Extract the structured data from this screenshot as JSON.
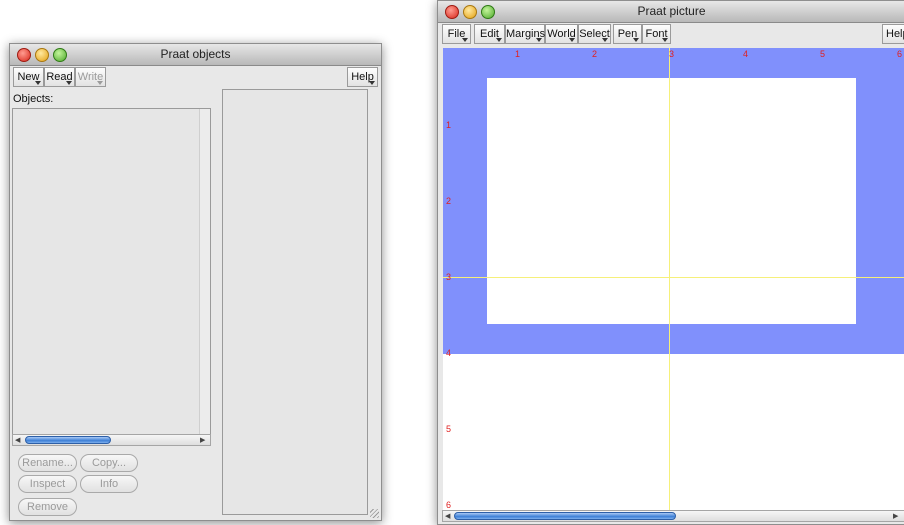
{
  "objects_window": {
    "title": "Praat objects",
    "menus": [
      {
        "label": "New",
        "enabled": true
      },
      {
        "label": "Read",
        "enabled": true
      },
      {
        "label": "Write",
        "enabled": false
      }
    ],
    "help_label": "Help",
    "objects_label": "Objects:",
    "buttons": {
      "rename": "Rename...",
      "copy": "Copy...",
      "inspect": "Inspect",
      "info": "Info",
      "remove": "Remove"
    }
  },
  "picture_window": {
    "title": "Praat picture",
    "menus": [
      "File",
      "Edit",
      "Margins",
      "World",
      "Select",
      "Pen",
      "Font"
    ],
    "help_label": "Help",
    "top_ruler": [
      "1",
      "2",
      "3",
      "4",
      "5",
      "6"
    ],
    "left_ruler": [
      "1",
      "2",
      "3",
      "4",
      "5",
      "6"
    ],
    "colors": {
      "selection": "#8090fc",
      "viewport": "#ffffff",
      "guide_lines": "#f6f07a",
      "ruler_numbers": "#e02020"
    }
  }
}
